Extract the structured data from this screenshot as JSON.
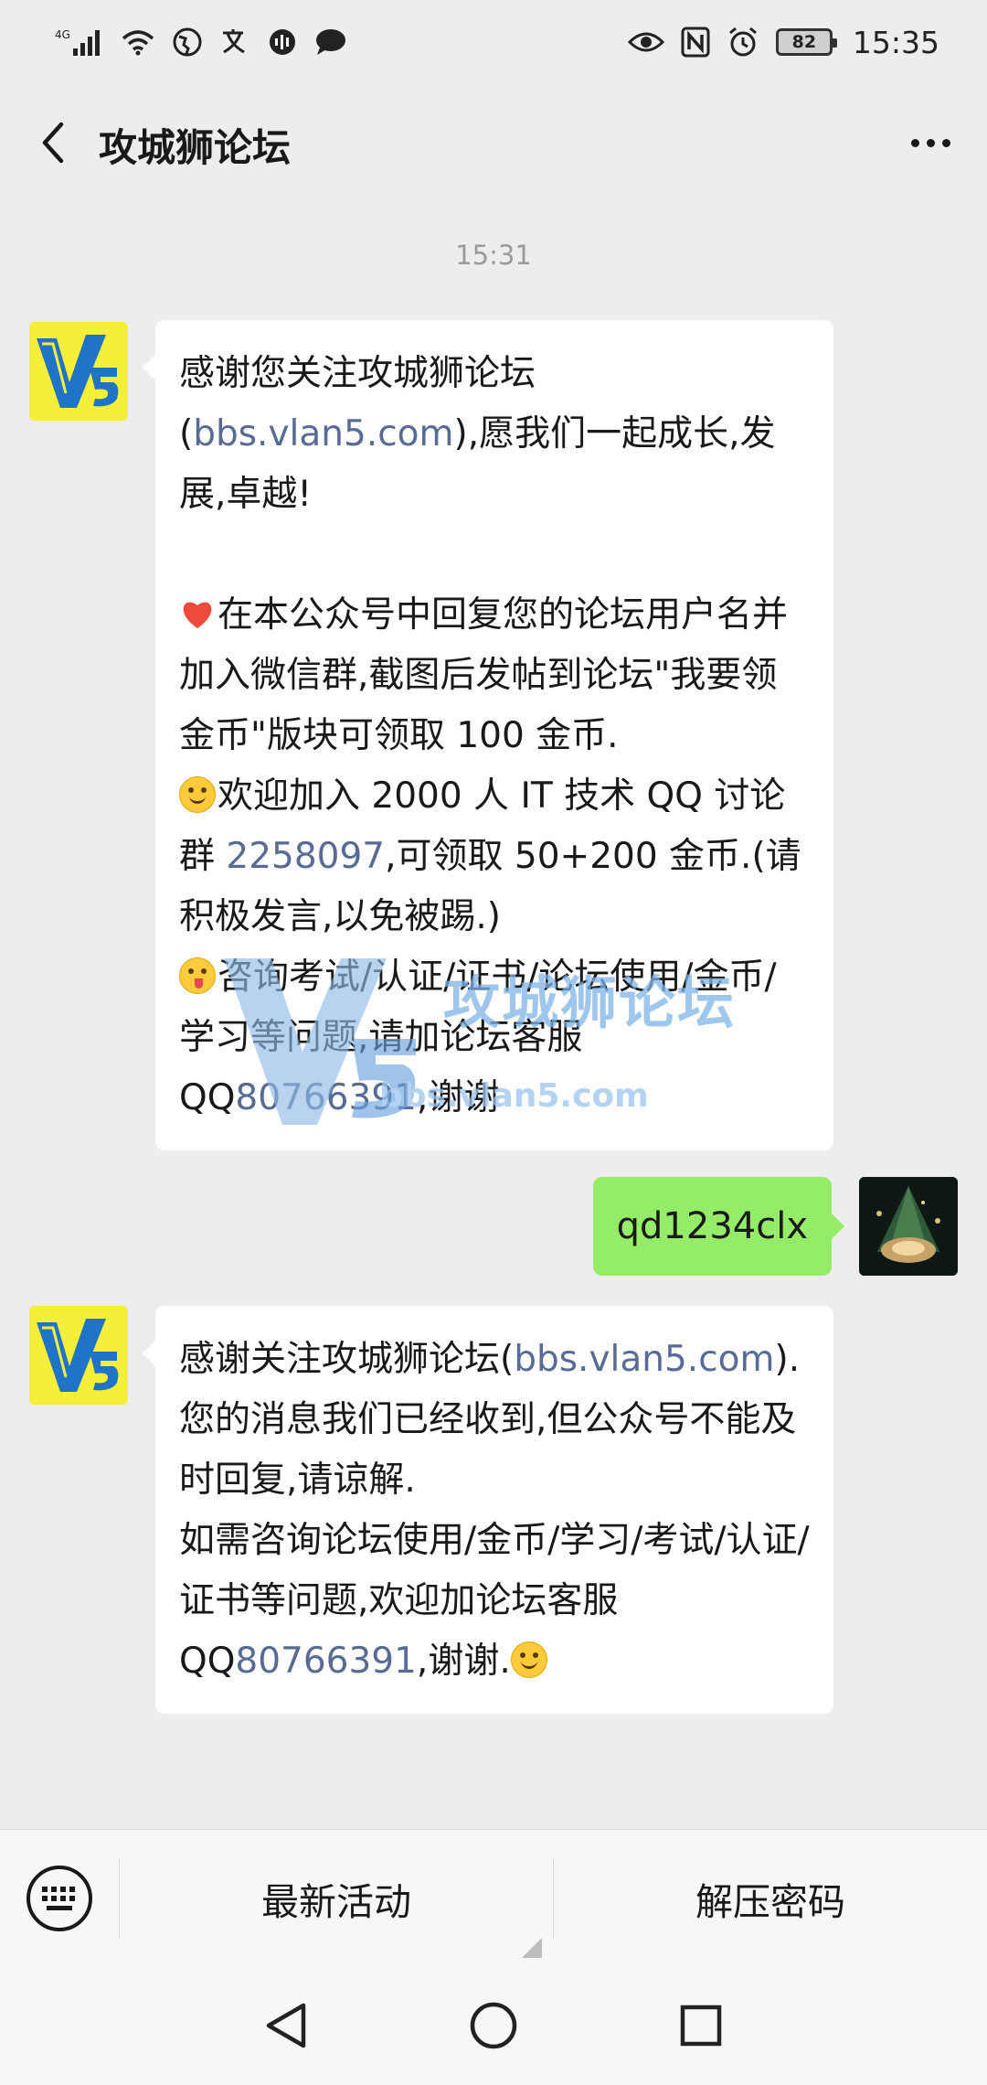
{
  "status_bar": {
    "network": "4G",
    "battery": "82",
    "time": "15:35"
  },
  "header": {
    "title": "攻城狮论坛"
  },
  "chat": {
    "timestamp": "15:31",
    "messages": [
      {
        "paragraphs": {
          "p1_a": "感谢您关注攻城狮论坛(",
          "p1_link": "bbs.vlan5.com",
          "p1_b": "),愿我们一起成长,发展,卓越!",
          "p2": "在本公众号中回复您的论坛用户名并加入微信群,截图后发帖到论坛\"我要领金币\"版块可领取 100 金币.",
          "p3_a": "欢迎加入 2000 人 IT 技术 QQ 讨论群 ",
          "p3_link": "2258097",
          "p3_b": ",可领取 50+200 金币.(请积极发言,以免被踢.)",
          "p4_a": "咨询考试/认证/证书/论坛使用/金币/学习等问题,请加论坛客服 QQ",
          "p4_link": "80766391",
          "p4_b": ",谢谢"
        }
      },
      {
        "text": "qd1234clx"
      },
      {
        "paragraphs": {
          "p1_a": "感谢关注攻城狮论坛(",
          "p1_link": "bbs.vlan5.com",
          "p1_b": ").",
          "p2": "您的消息我们已经收到,但公众号不能及时回复,请谅解.",
          "p3_a": "如需咨询论坛使用/金币/学习/考试/认证/证书等问题,欢迎加论坛客服 QQ",
          "p3_link": "80766391",
          "p3_b": ",谢谢."
        }
      }
    ]
  },
  "watermark": {
    "brand": "攻城狮论坛",
    "url": "bbs.vlan5.com"
  },
  "bottom_menu": {
    "items": [
      "最新活动",
      "解压密码"
    ]
  },
  "colors": {
    "background": "#ededed",
    "outgoing_bubble": "#95ec69",
    "link": "#576b95"
  }
}
